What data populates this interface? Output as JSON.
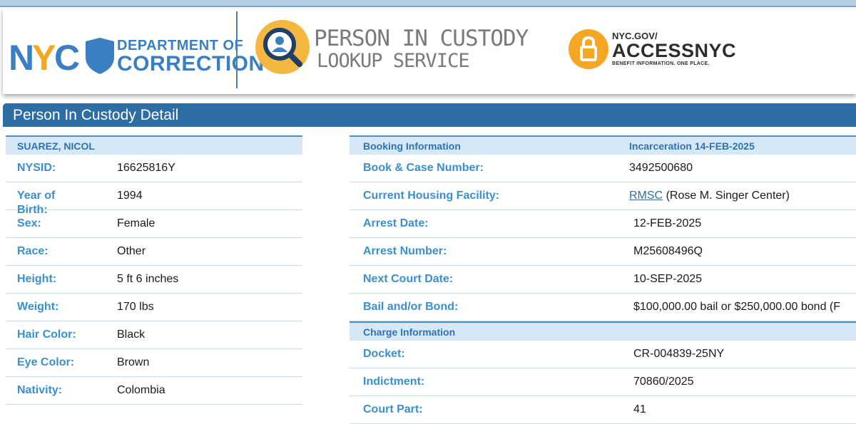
{
  "header": {
    "nyc_logo_text": "NYC",
    "dept_line1": "DEPARTMENT OF",
    "dept_line2": "CORRECTION",
    "service_line1": "PERSON IN CUSTODY",
    "service_line2": "LOOKUP SERVICE",
    "access_line1": "NYC.GOV/",
    "access_line2": "ACCESSNYC",
    "access_tagline": "BENEFIT INFORMATION. ONE PLACE."
  },
  "section_title": "Person In Custody Detail",
  "person": {
    "name": "SUAREZ, NICOL",
    "fields": [
      {
        "label": "NYSID:",
        "value": "16625816Y"
      },
      {
        "label": "Year of Birth:",
        "value": "1994"
      },
      {
        "label": "Sex:",
        "value": "Female"
      },
      {
        "label": "Race:",
        "value": "Other"
      },
      {
        "label": "Height:",
        "value": "5 ft 6 inches"
      },
      {
        "label": "Weight:",
        "value": "170 lbs"
      },
      {
        "label": "Hair Color:",
        "value": "Black"
      },
      {
        "label": "Eye Color:",
        "value": "Brown"
      },
      {
        "label": "Nativity:",
        "value": "Colombia"
      }
    ]
  },
  "booking": {
    "header_label": "Booking Information",
    "header_value": "Incarceration 14-FEB-2025",
    "fields": [
      {
        "label": "Book & Case Number:",
        "value": "3492500680"
      },
      {
        "label": "Current Housing Facility:",
        "link": "RMSC",
        "value": "(Rose M. Singer Center)"
      },
      {
        "label": "Arrest Date:",
        "value": "12-FEB-2025"
      },
      {
        "label": "Arrest Number:",
        "value": "M25608496Q"
      },
      {
        "label": "Next Court Date:",
        "value": "10-SEP-2025"
      },
      {
        "label": "Bail and/or Bond:",
        "value": "$100,000.00 bail or $250,000.00 bond (F"
      }
    ]
  },
  "charge": {
    "header_label": "Charge Information",
    "fields": [
      {
        "label": "Docket:",
        "value": "CR-004839-25NY"
      },
      {
        "label": "Indictment:",
        "value": "70860/2025"
      },
      {
        "label": "Court Part:",
        "value": "41"
      }
    ]
  },
  "colors": {
    "accent": "#2e6da4",
    "label_blue": "#3a8fcf",
    "header_row_bg": "#d6e8f5",
    "nyc_orange": "#f5a623",
    "access_orange": "#f5a623"
  }
}
